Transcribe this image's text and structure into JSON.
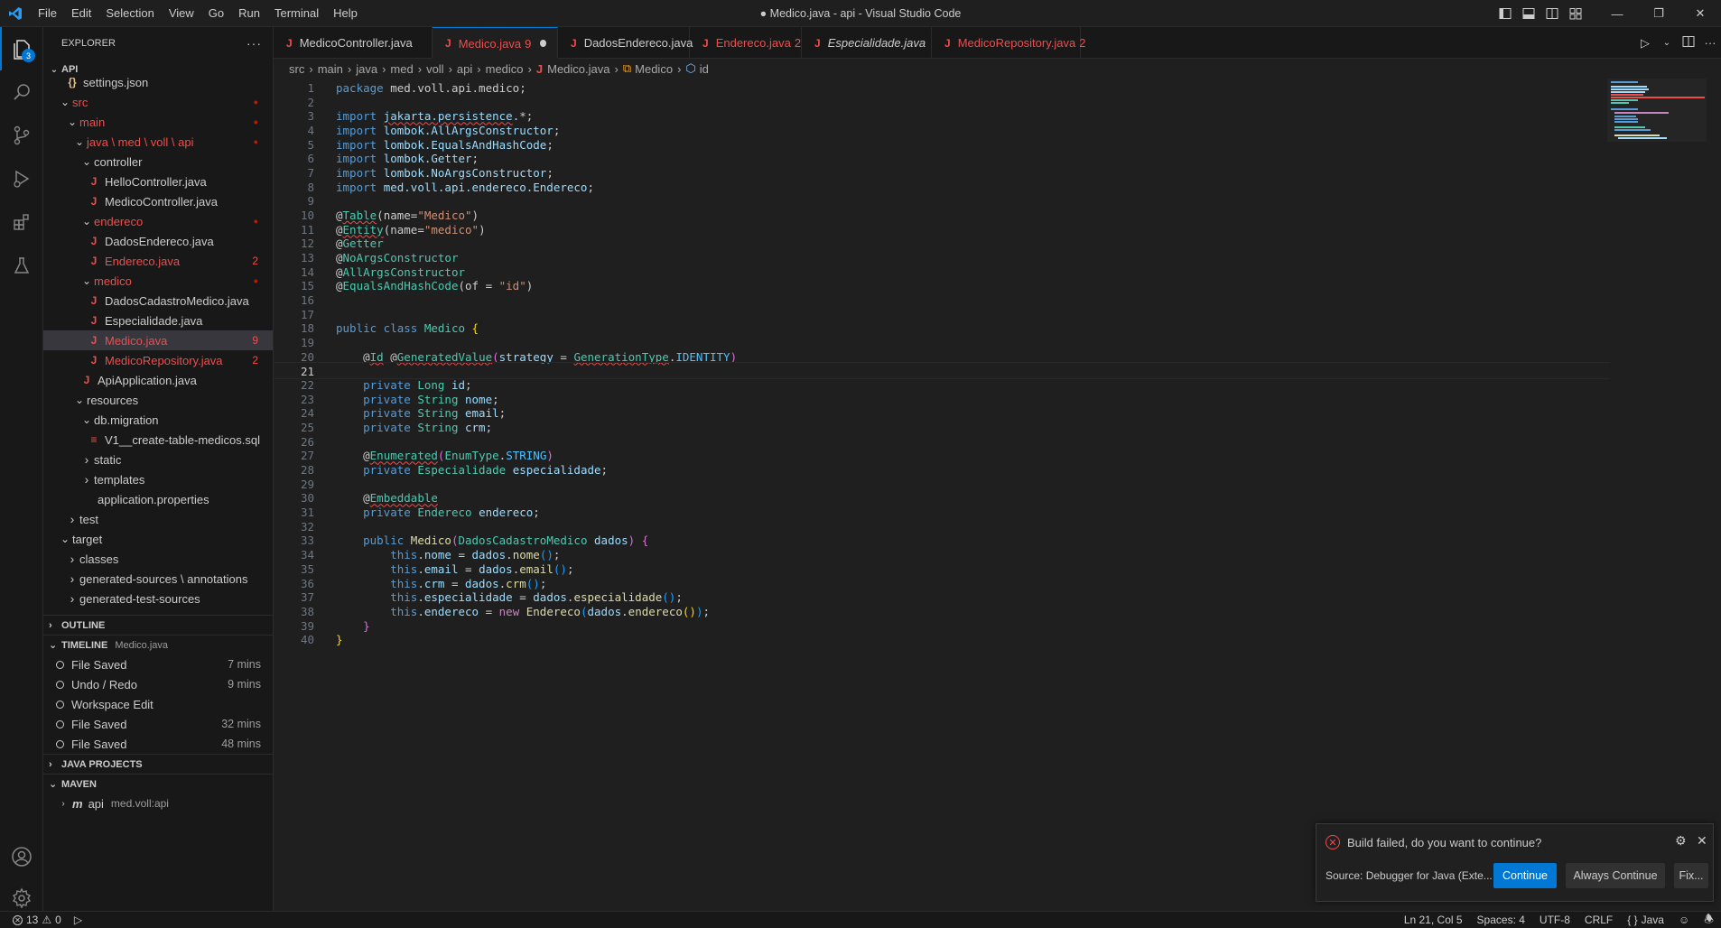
{
  "window": {
    "title": "● Medico.java - api - Visual Studio Code"
  },
  "menu": [
    "File",
    "Edit",
    "Selection",
    "View",
    "Go",
    "Run",
    "Terminal",
    "Help"
  ],
  "activity": {
    "explorer_badge": "3"
  },
  "explorer": {
    "title": "EXPLORER",
    "more": "···",
    "root": "API",
    "tree": [
      {
        "label": "settings.json",
        "depth": 2,
        "icon": "{}",
        "chev": ""
      },
      {
        "label": "src",
        "depth": 1,
        "chev": "v",
        "err": true,
        "dot": true
      },
      {
        "label": "main",
        "depth": 2,
        "chev": "v",
        "err": true,
        "dot": true
      },
      {
        "label": "java \\ med \\ voll \\ api",
        "depth": 3,
        "chev": "v",
        "err": true,
        "dot": true
      },
      {
        "label": "controller",
        "depth": 4,
        "chev": "v"
      },
      {
        "label": "HelloController.java",
        "depth": 5,
        "icon": "J"
      },
      {
        "label": "MedicoController.java",
        "depth": 5,
        "icon": "J"
      },
      {
        "label": "endereco",
        "depth": 4,
        "chev": "v",
        "err": true,
        "dot": true
      },
      {
        "label": "DadosEndereco.java",
        "depth": 5,
        "icon": "J"
      },
      {
        "label": "Endereco.java",
        "depth": 5,
        "icon": "J",
        "err": true,
        "count": "2"
      },
      {
        "label": "medico",
        "depth": 4,
        "chev": "v",
        "err": true,
        "dot": true
      },
      {
        "label": "DadosCadastroMedico.java",
        "depth": 5,
        "icon": "J"
      },
      {
        "label": "Especialidade.java",
        "depth": 5,
        "icon": "J"
      },
      {
        "label": "Medico.java",
        "depth": 5,
        "icon": "J",
        "err": true,
        "count": "9",
        "selected": true
      },
      {
        "label": "MedicoRepository.java",
        "depth": 5,
        "icon": "J",
        "err": true,
        "count": "2"
      },
      {
        "label": "ApiApplication.java",
        "depth": 4,
        "icon": "J"
      },
      {
        "label": "resources",
        "depth": 3,
        "chev": "v"
      },
      {
        "label": "db.migration",
        "depth": 4,
        "chev": "v"
      },
      {
        "label": "V1__create-table-medicos.sql",
        "depth": 5,
        "icon": "≡"
      },
      {
        "label": "static",
        "depth": 4,
        "chev": ">"
      },
      {
        "label": "templates",
        "depth": 4,
        "chev": ">"
      },
      {
        "label": "application.properties",
        "depth": 4,
        "icon": ""
      },
      {
        "label": "test",
        "depth": 2,
        "chev": ">"
      },
      {
        "label": "target",
        "depth": 1,
        "chev": "v"
      },
      {
        "label": "classes",
        "depth": 2,
        "chev": ">"
      },
      {
        "label": "generated-sources \\ annotations",
        "depth": 2,
        "chev": ">"
      },
      {
        "label": "generated-test-sources",
        "depth": 2,
        "chev": ">"
      }
    ]
  },
  "outline": {
    "title": "OUTLINE"
  },
  "timeline": {
    "title": "TIMELINE",
    "file": "Medico.java",
    "items": [
      {
        "label": "File Saved",
        "time": "7 mins"
      },
      {
        "label": "Undo / Redo",
        "time": "9 mins"
      },
      {
        "label": "Workspace Edit",
        "time": ""
      },
      {
        "label": "File Saved",
        "time": "32 mins"
      },
      {
        "label": "File Saved",
        "time": "48 mins"
      }
    ]
  },
  "java_projects": {
    "title": "JAVA PROJECTS"
  },
  "maven": {
    "title": "MAVEN",
    "project": "api",
    "project_id": "med.voll:api"
  },
  "tabs": [
    {
      "label": "MedicoController.java",
      "state": ""
    },
    {
      "label": "Medico.java",
      "state": "9",
      "active": true,
      "modified": true
    },
    {
      "label": "DadosEndereco.java",
      "state": ""
    },
    {
      "label": "Endereco.java",
      "state": "2"
    },
    {
      "label": "Especialidade.java",
      "state": ""
    },
    {
      "label": "MedicoRepository.java",
      "state": "2",
      "modified": true
    }
  ],
  "breadcrumb": [
    "src",
    "main",
    "java",
    "med",
    "voll",
    "api",
    "medico",
    "Medico.java",
    "Medico",
    "id"
  ],
  "editor": {
    "current_line": 21,
    "lines": [
      [
        [
          "kw",
          "package "
        ],
        [
          "pl",
          "med.voll.api.medico;"
        ]
      ],
      [],
      [
        [
          "kw",
          "import "
        ],
        [
          "var sq",
          "jakarta.persistence"
        ],
        [
          "pl",
          ".*;"
        ]
      ],
      [
        [
          "kw",
          "import "
        ],
        [
          "var",
          "lombok.AllArgsConstructor"
        ],
        [
          "pl",
          ";"
        ]
      ],
      [
        [
          "kw",
          "import "
        ],
        [
          "var",
          "lombok.EqualsAndHashCode"
        ],
        [
          "pl",
          ";"
        ]
      ],
      [
        [
          "kw",
          "import "
        ],
        [
          "var",
          "lombok.Getter"
        ],
        [
          "pl",
          ";"
        ]
      ],
      [
        [
          "kw",
          "import "
        ],
        [
          "var",
          "lombok.NoArgsConstructor"
        ],
        [
          "pl",
          ";"
        ]
      ],
      [
        [
          "kw",
          "import "
        ],
        [
          "var",
          "med.voll.api.endereco.Endereco"
        ],
        [
          "pl",
          ";"
        ]
      ],
      [],
      [
        [
          "pl",
          "@"
        ],
        [
          "ann sq",
          "Table"
        ],
        [
          "pl",
          "(name="
        ],
        [
          "str",
          "\"Medico\""
        ],
        [
          "pl",
          ")"
        ]
      ],
      [
        [
          "pl",
          "@"
        ],
        [
          "ann sq",
          "Entity"
        ],
        [
          "pl",
          "(name="
        ],
        [
          "str",
          "\"medico\""
        ],
        [
          "pl",
          ")"
        ]
      ],
      [
        [
          "pl",
          "@"
        ],
        [
          "ann",
          "Getter"
        ]
      ],
      [
        [
          "pl",
          "@"
        ],
        [
          "ann",
          "NoArgsConstructor"
        ]
      ],
      [
        [
          "pl",
          "@"
        ],
        [
          "ann",
          "AllArgsConstructor"
        ]
      ],
      [
        [
          "pl",
          "@"
        ],
        [
          "ann",
          "EqualsAndHashCode"
        ],
        [
          "pl",
          "(of = "
        ],
        [
          "str",
          "\"id\""
        ],
        [
          "pl",
          ")"
        ]
      ],
      [],
      [],
      [
        [
          "kw",
          "public class "
        ],
        [
          "ty",
          "Medico"
        ],
        [
          "pl",
          " "
        ],
        [
          "br1",
          "{"
        ]
      ],
      [],
      [
        [
          "pl",
          "    @"
        ],
        [
          "ann sq",
          "Id"
        ],
        [
          "pl",
          " @"
        ],
        [
          "ann sq",
          "GeneratedValue"
        ],
        [
          "br2",
          "("
        ],
        [
          "var",
          "strategy"
        ],
        [
          "pl",
          " = "
        ],
        [
          "ty sq",
          "GenerationType"
        ],
        [
          "pl",
          "."
        ],
        [
          "cst",
          "IDENTITY"
        ],
        [
          "br2",
          ")"
        ]
      ],
      [],
      [
        [
          "kw",
          "    private "
        ],
        [
          "ty",
          "Long"
        ],
        [
          "pl",
          " "
        ],
        [
          "var",
          "id"
        ],
        [
          "pl",
          ";"
        ]
      ],
      [
        [
          "kw",
          "    private "
        ],
        [
          "ty",
          "String"
        ],
        [
          "pl",
          " "
        ],
        [
          "var",
          "nome"
        ],
        [
          "pl",
          ";"
        ]
      ],
      [
        [
          "kw",
          "    private "
        ],
        [
          "ty",
          "String"
        ],
        [
          "pl",
          " "
        ],
        [
          "var",
          "email"
        ],
        [
          "pl",
          ";"
        ]
      ],
      [
        [
          "kw",
          "    private "
        ],
        [
          "ty",
          "String"
        ],
        [
          "pl",
          " "
        ],
        [
          "var",
          "crm"
        ],
        [
          "pl",
          ";"
        ]
      ],
      [],
      [
        [
          "pl",
          "    @"
        ],
        [
          "ann sq",
          "Enumerated"
        ],
        [
          "br2",
          "("
        ],
        [
          "ty",
          "EnumType"
        ],
        [
          "pl",
          "."
        ],
        [
          "cst",
          "STRING"
        ],
        [
          "br2",
          ")"
        ]
      ],
      [
        [
          "kw",
          "    private "
        ],
        [
          "ty",
          "Especialidade"
        ],
        [
          "pl",
          " "
        ],
        [
          "var",
          "especialidade"
        ],
        [
          "pl",
          ";"
        ]
      ],
      [],
      [
        [
          "pl",
          "    @"
        ],
        [
          "ann sq",
          "Embeddable"
        ]
      ],
      [
        [
          "kw",
          "    private "
        ],
        [
          "ty",
          "Endereco"
        ],
        [
          "pl",
          " "
        ],
        [
          "var",
          "endereco"
        ],
        [
          "pl",
          ";"
        ]
      ],
      [],
      [
        [
          "kw",
          "    public "
        ],
        [
          "fn",
          "Medico"
        ],
        [
          "br2",
          "("
        ],
        [
          "ty",
          "DadosCadastroMedico"
        ],
        [
          "pl",
          " "
        ],
        [
          "var",
          "dados"
        ],
        [
          "br2",
          ")"
        ],
        [
          "pl",
          " "
        ],
        [
          "br2",
          "{"
        ]
      ],
      [
        [
          "kw",
          "        this"
        ],
        [
          "pl",
          "."
        ],
        [
          "var",
          "nome"
        ],
        [
          "pl",
          " = "
        ],
        [
          "var",
          "dados"
        ],
        [
          "pl",
          "."
        ],
        [
          "fn",
          "nome"
        ],
        [
          "br3",
          "()"
        ],
        [
          "pl",
          ";"
        ]
      ],
      [
        [
          "kw",
          "        this"
        ],
        [
          "pl",
          "."
        ],
        [
          "var",
          "email"
        ],
        [
          "pl",
          " = "
        ],
        [
          "var",
          "dados"
        ],
        [
          "pl",
          "."
        ],
        [
          "fn",
          "email"
        ],
        [
          "br3",
          "()"
        ],
        [
          "pl",
          ";"
        ]
      ],
      [
        [
          "kw",
          "        this"
        ],
        [
          "pl",
          "."
        ],
        [
          "var",
          "crm"
        ],
        [
          "pl",
          " = "
        ],
        [
          "var",
          "dados"
        ],
        [
          "pl",
          "."
        ],
        [
          "fn",
          "crm"
        ],
        [
          "br3",
          "()"
        ],
        [
          "pl",
          ";"
        ]
      ],
      [
        [
          "kw",
          "        this"
        ],
        [
          "pl",
          "."
        ],
        [
          "var",
          "especialidade"
        ],
        [
          "pl",
          " = "
        ],
        [
          "var",
          "dados"
        ],
        [
          "pl",
          "."
        ],
        [
          "fn",
          "especialidade"
        ],
        [
          "br3",
          "()"
        ],
        [
          "pl",
          ";"
        ]
      ],
      [
        [
          "kw",
          "        this"
        ],
        [
          "pl",
          "."
        ],
        [
          "var",
          "endereco"
        ],
        [
          "pl",
          " = "
        ],
        [
          "ctl",
          "new "
        ],
        [
          "fn",
          "Endereco"
        ],
        [
          "br3",
          "("
        ],
        [
          "var",
          "dados"
        ],
        [
          "pl",
          "."
        ],
        [
          "fn",
          "endereco"
        ],
        [
          "br1",
          "()"
        ],
        [
          "br3",
          ")"
        ],
        [
          "pl",
          ";"
        ]
      ],
      [
        [
          "br2",
          "    }"
        ]
      ],
      [
        [
          "br1",
          "}"
        ]
      ]
    ]
  },
  "notification": {
    "message": "Build failed, do you want to continue?",
    "source": "Source: Debugger for Java (Exte...",
    "continue": "Continue",
    "always": "Always Continue",
    "fix": "Fix..."
  },
  "status": {
    "errors": "13",
    "warnings": "0",
    "position": "Ln 21, Col 5",
    "spaces": "Spaces: 4",
    "encoding": "UTF-8",
    "eol": "CRLF",
    "language": "Java"
  },
  "colors": {
    "accent": "#0078d4",
    "error": "#f14c4c"
  }
}
